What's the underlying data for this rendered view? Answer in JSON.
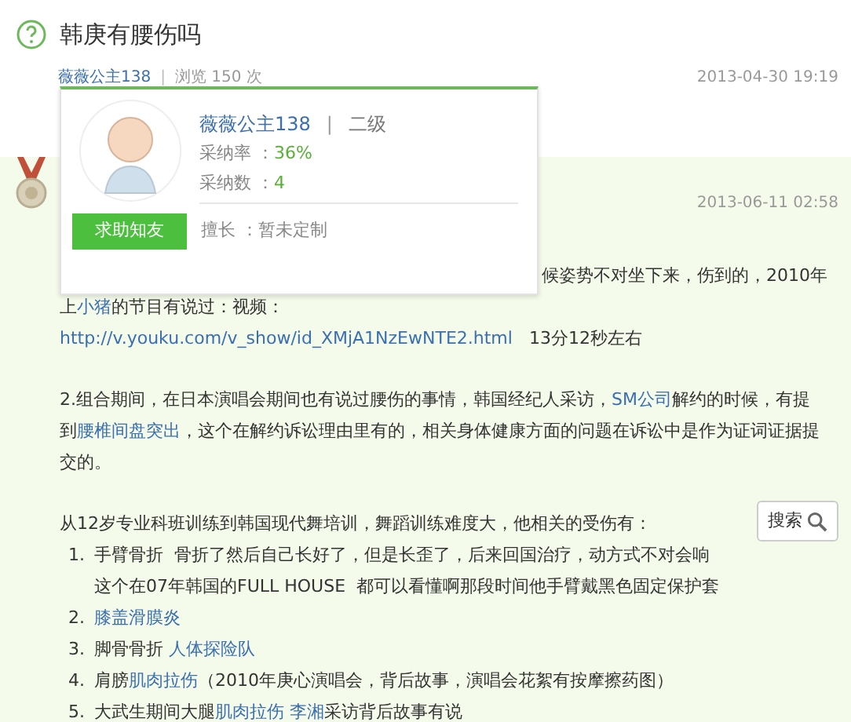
{
  "question": {
    "title": "韩庚有腰伤吗",
    "asker": "薇薇公主138",
    "separator": "|",
    "views": "浏览 150 次",
    "date": "2013-04-30 19:19"
  },
  "popup": {
    "name": "薇薇公主138",
    "separator": "|",
    "level": "二级",
    "rows": [
      {
        "label": "采纳率 ：",
        "value": "36%"
      },
      {
        "label": "采纳数 ：",
        "value": "4"
      }
    ],
    "button": "求助知友",
    "specialty_label": "擅长 ：",
    "specialty": "暂未定制"
  },
  "answer": {
    "date": "2013-06-11 02:58",
    "paragraphs": [
      [
        [
          {
            "text": "候姿势不对坐下来，伤到的，2010年",
            "link": false
          }
        ],
        [
          {
            "text": "上",
            "link": false
          },
          {
            "text": "小猪",
            "link": true
          },
          {
            "text": "的节目有说过：视频：",
            "link": false
          }
        ],
        [
          {
            "text": "http://v.youku.com/v_show/id_XMjA1NzEwNTE2.html",
            "link": true
          },
          {
            "text": "   13分12秒左右",
            "link": false
          }
        ]
      ],
      [
        [
          {
            "text": "2.组合期间，在日本演唱会期间也有说过腰伤的事情，韩国经纪人采访，",
            "link": false
          },
          {
            "text": "SM公司",
            "link": true
          },
          {
            "text": "解约的时候，有提",
            "link": false
          }
        ],
        [
          {
            "text": "到",
            "link": false
          },
          {
            "text": "腰椎间盘突出",
            "link": true
          },
          {
            "text": "，这个在解约诉讼理由里有的，相关身体健康方面的问题在诉讼中是作为证词证据提",
            "link": false
          }
        ],
        [
          {
            "text": "交的。",
            "link": false
          }
        ]
      ],
      [
        [
          {
            "text": "从12岁专业科班训练到韩国现代舞培训，舞蹈训练难度大，他相关的受伤有：",
            "link": false
          }
        ]
      ]
    ],
    "list": [
      {
        "number": "1.",
        "lines": [
          [
            {
              "text": "手臂骨折  骨折了然后自己长好了，但是长歪了，后来回国治疗，动方式不对会响",
              "link": false
            }
          ],
          [
            {
              "text": "这个在07年韩国的FULL HOUSE  都可以看懂啊那段时间他手臂戴黑色固定保护套",
              "link": false
            }
          ]
        ]
      },
      {
        "number": "2.",
        "lines": [
          [
            {
              "text": "膝盖滑膜炎",
              "link": true
            }
          ]
        ]
      },
      {
        "number": "3.",
        "lines": [
          [
            {
              "text": "脚骨骨折",
              "link": false
            },
            {
              "text": " 人体探险队",
              "link": true
            }
          ]
        ]
      },
      {
        "number": "4.",
        "lines": [
          [
            {
              "text": "肩膀",
              "link": false
            },
            {
              "text": "肌肉拉伤",
              "link": true
            },
            {
              "text": "（2010年庚心演唱会，背后故事，演唱会花絮有按摩擦药图）",
              "link": false
            }
          ]
        ]
      },
      {
        "number": "5.",
        "lines": [
          [
            {
              "text": "大武生期间大腿",
              "link": false
            },
            {
              "text": "肌肉拉伤",
              "link": true
            },
            {
              "text": " 李湘",
              "link": true
            },
            {
              "text": "采访背后故事有说",
              "link": false
            }
          ]
        ]
      }
    ]
  },
  "search_button": "搜索"
}
